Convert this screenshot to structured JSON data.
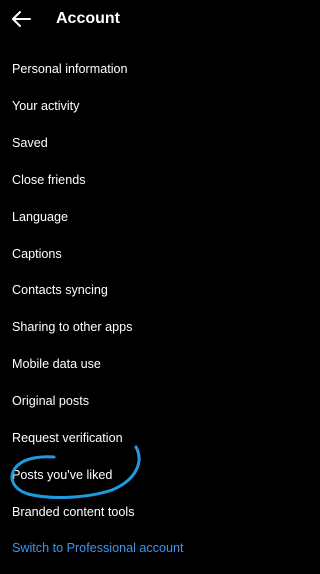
{
  "header": {
    "back_icon": "arrow-left-icon",
    "title": "Account"
  },
  "menu": {
    "items": [
      {
        "label": "Personal information"
      },
      {
        "label": "Your activity"
      },
      {
        "label": "Saved"
      },
      {
        "label": "Close friends"
      },
      {
        "label": "Language"
      },
      {
        "label": "Captions"
      },
      {
        "label": "Contacts syncing"
      },
      {
        "label": "Sharing to other apps"
      },
      {
        "label": "Mobile data use"
      },
      {
        "label": "Original posts"
      },
      {
        "label": "Request verification"
      },
      {
        "label": "Posts you've liked"
      },
      {
        "label": "Branded content tools"
      }
    ],
    "professional_link": "Switch to Professional account"
  },
  "colors": {
    "background": "#000000",
    "text": "#ffffff",
    "link": "#3897f0",
    "annotation_circle": "#1e9be0"
  }
}
